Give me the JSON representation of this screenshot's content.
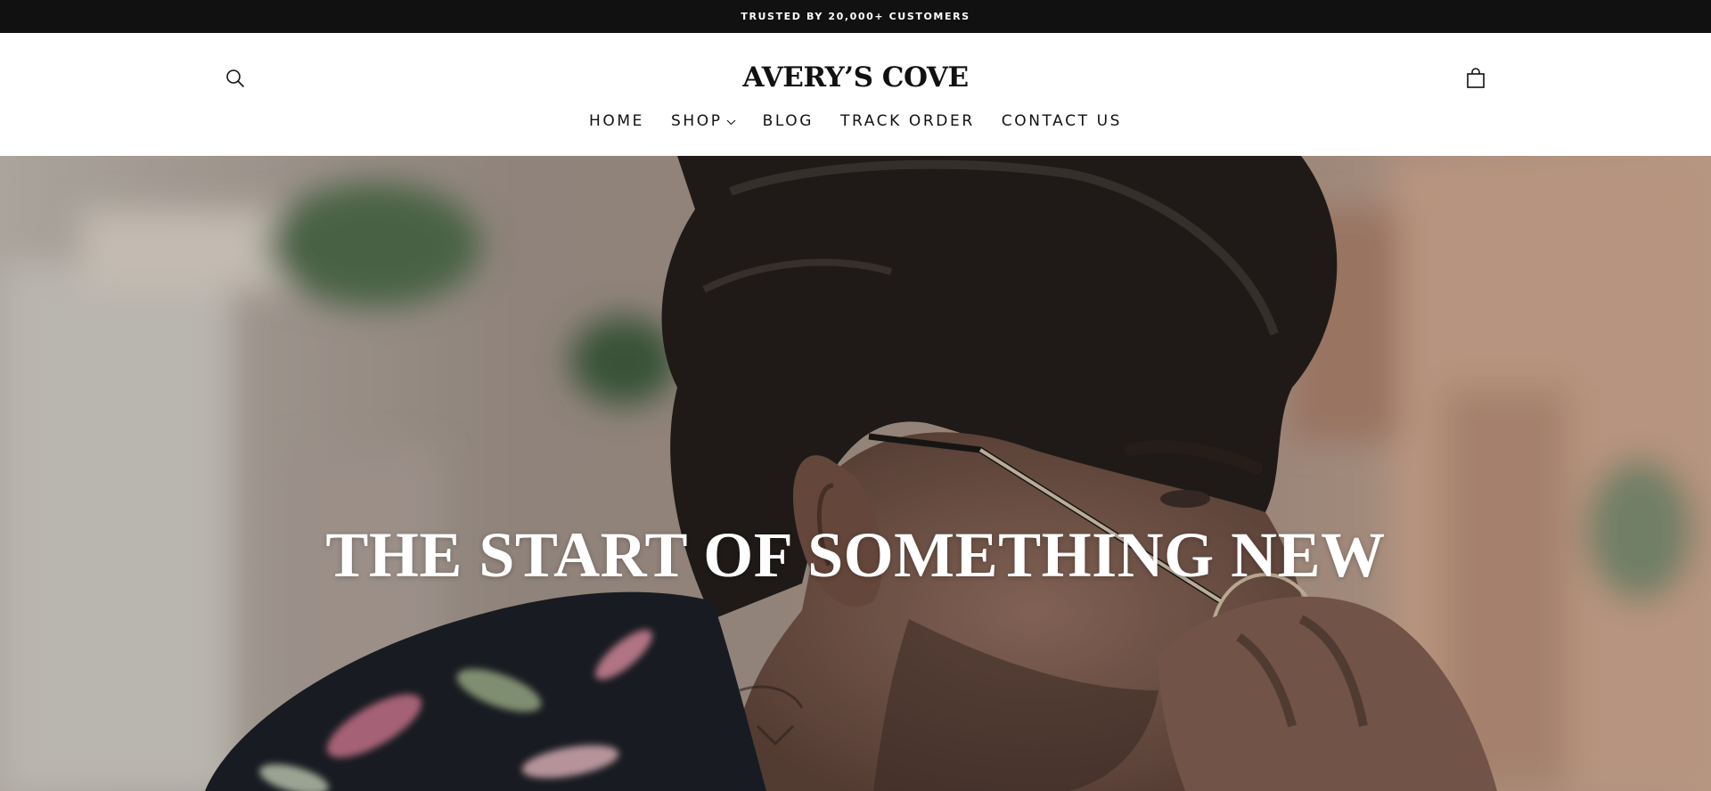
{
  "announcement": {
    "text": "TRUSTED BY 20,000+ CUSTOMERS"
  },
  "header": {
    "logo": "AVERY’S COVE",
    "search_icon": "search-icon",
    "cart_icon": "shopping-bag-icon"
  },
  "nav": {
    "items": [
      {
        "label": "HOME"
      },
      {
        "label": "SHOP",
        "icon": "chevron-down-icon"
      },
      {
        "label": "BLOG"
      },
      {
        "label": "TRACK ORDER"
      },
      {
        "label": "CONTACT US"
      }
    ]
  },
  "hero": {
    "title": "THE START OF SOMETHING NEW",
    "image_subject": "man-with-sunglasses-photo"
  },
  "colors": {
    "announcement_bg": "#111111",
    "header_bg": "#ffffff",
    "text": "#111111",
    "hero_text": "#ffffff"
  }
}
